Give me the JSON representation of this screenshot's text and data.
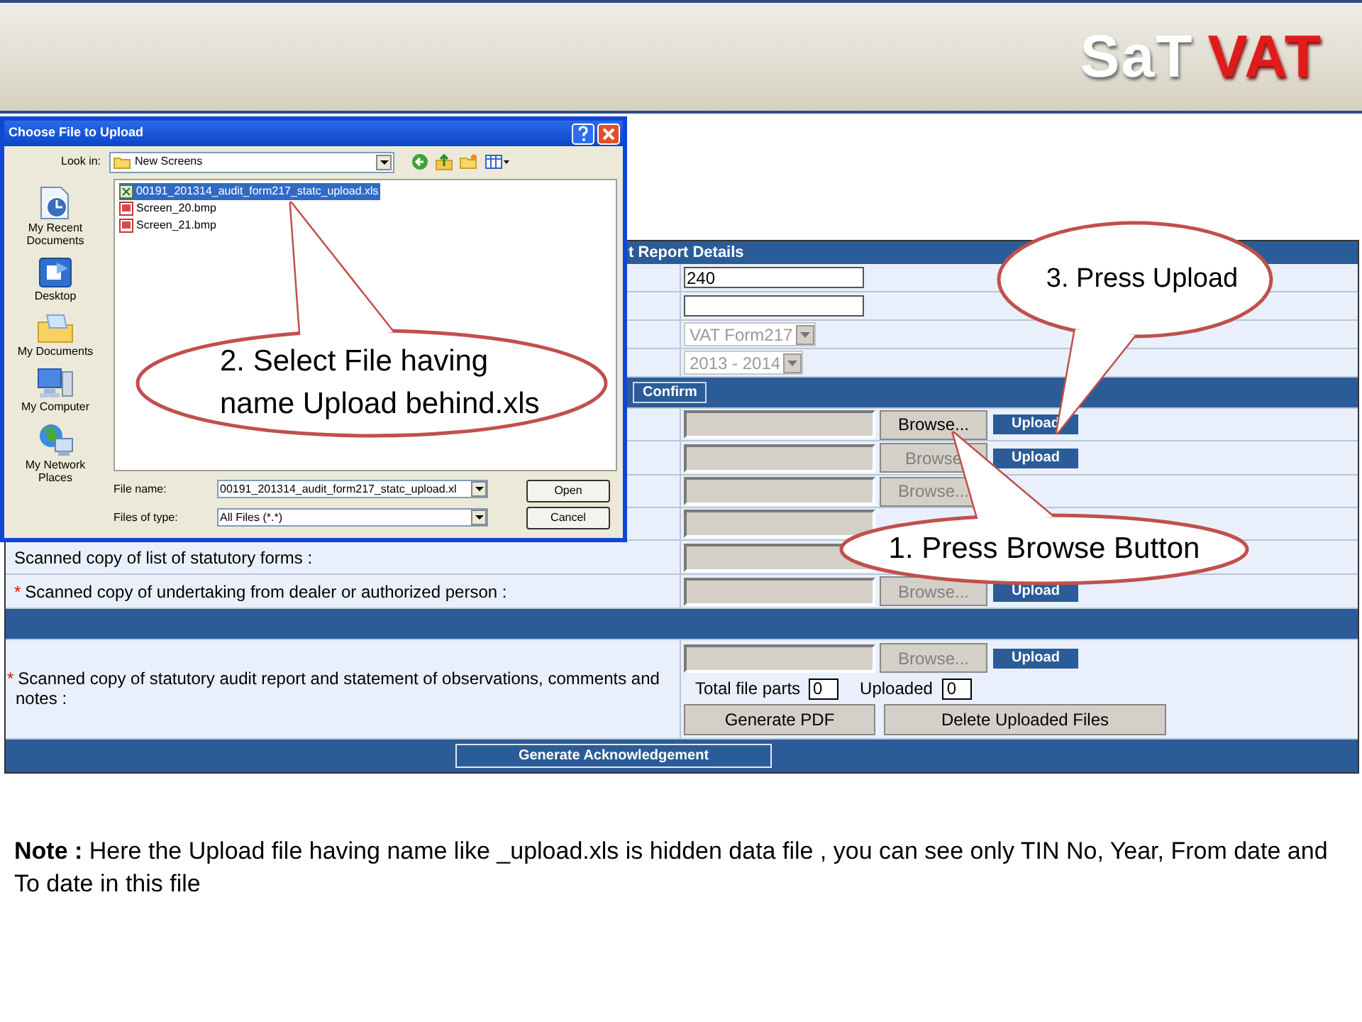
{
  "header": {
    "logo": [
      {
        "text": "SaT",
        "kind": "plain"
      },
      {
        "text": "VAT",
        "kind": "accent"
      }
    ]
  },
  "form": {
    "title": "t Report Details",
    "fields": [
      {
        "kind": "text",
        "value": "240"
      },
      {
        "kind": "text"
      },
      {
        "kind": "select",
        "value": "VAT Form217",
        "disabled": true
      },
      {
        "kind": "select",
        "value": "2013 - 2014",
        "disabled": true
      }
    ],
    "confirm_button": "Confirm",
    "upload_rows": [
      {
        "browse": {
          "label": "Browse...",
          "disabled": false
        },
        "upload": "Upload"
      },
      {
        "browse": {
          "label": "Browse",
          "disabled": true
        },
        "upload": "Upload"
      },
      {
        "browse": {
          "label": "Browse...",
          "disabled": true
        }
      },
      {},
      {
        "label": "Scanned copy of list of statutory forms :"
      },
      {
        "mark": "*",
        "label": "Scanned copy of undertaking from dealer or authorized person :",
        "browse": {
          "label": "Browse...",
          "disabled": true
        },
        "upload": "Upload"
      }
    ],
    "audit_row": {
      "mark": "*",
      "label": "Scanned copy of statutory audit report and statement of observations, comments and notes :",
      "browse": {
        "label": "Browse...",
        "disabled": true
      },
      "upload": "Upload",
      "total_label": "Total file parts",
      "total_value": "0",
      "uploaded_label": "Uploaded",
      "uploaded_value": "0",
      "buttons": [
        "Generate PDF",
        "Delete Uploaded Files"
      ]
    },
    "acknowledge_button": "Generate Acknowledgement"
  },
  "dialog": {
    "title": "Choose File to Upload",
    "look_in_label": "Look in:",
    "look_in_value": "New Screens",
    "places": [
      {
        "label": "My Recent Documents",
        "kind": "recent"
      },
      {
        "label": "Desktop",
        "kind": "desktop"
      },
      {
        "label": "My Documents",
        "kind": "documents"
      },
      {
        "label": "My Computer",
        "kind": "computer"
      },
      {
        "label": "My Network Places",
        "kind": "network"
      }
    ],
    "files": [
      {
        "name": "00191_201314_audit_form217_statc_upload.xls",
        "kind": "xls",
        "selected": true
      },
      {
        "name": "Screen_20.bmp",
        "kind": "bmp",
        "selected": false
      },
      {
        "name": "Screen_21.bmp",
        "kind": "bmp",
        "selected": false
      }
    ],
    "file_name_label": "File name:",
    "file_name_value": "00191_201314_audit_form217_statc_upload.xl",
    "file_type_label": "Files of type:",
    "file_type_value": "All Files (*.*)",
    "buttons": [
      "Open",
      "Cancel"
    ]
  },
  "callouts": [
    {
      "lines": [
        "2. Select File having",
        "name Upload behind.xls"
      ]
    },
    {
      "lines": [
        "3. Press Upload"
      ]
    },
    {
      "lines": [
        "1. Press Browse Button"
      ]
    }
  ],
  "note": "**Note :** Here the Upload file having name like _upload.xls is hidden data file , you can see only TIN No, Year, From date and To date in this file"
}
